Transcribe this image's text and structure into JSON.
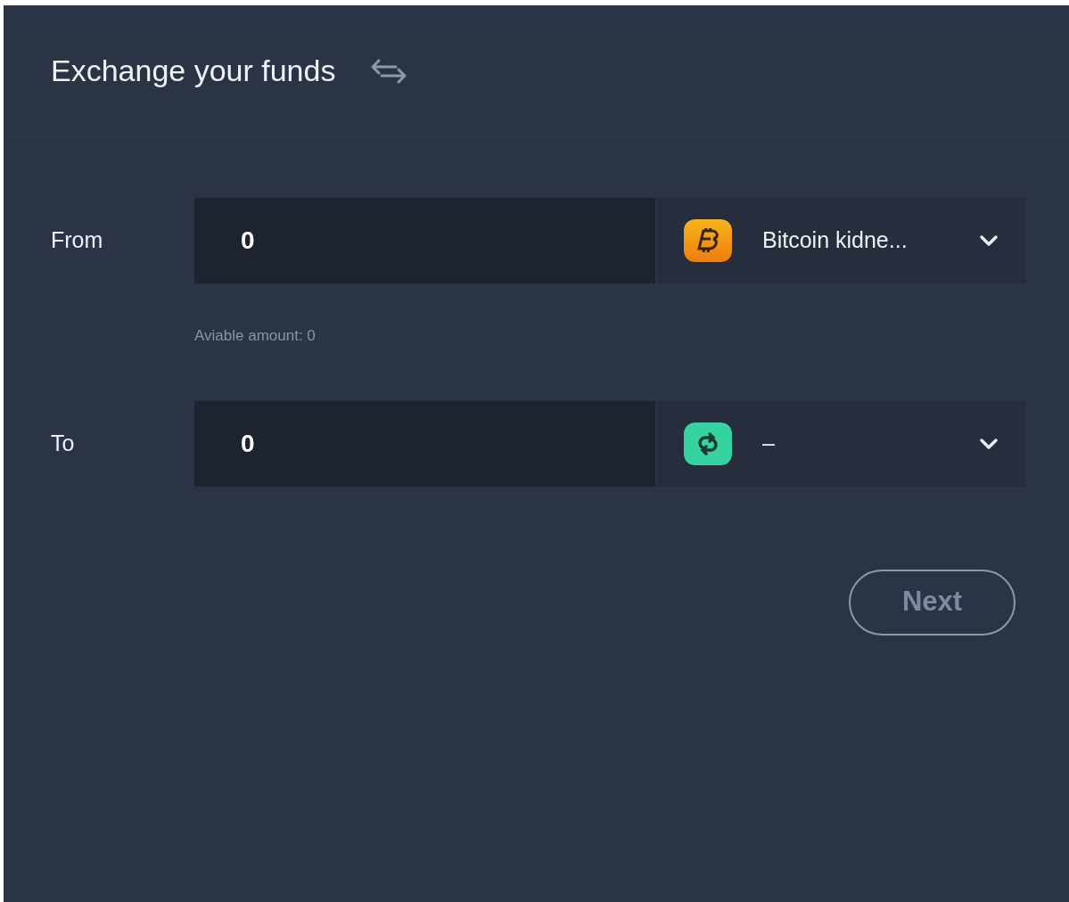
{
  "header": {
    "title": "Exchange your funds"
  },
  "rows": [
    {
      "label": "From",
      "amount": "0",
      "currency": {
        "kind": "bitcoin",
        "name": "Bitcoin kidne..."
      },
      "hint": "Aviable amount: 0"
    },
    {
      "label": "To",
      "amount": "0",
      "currency": {
        "kind": "exchange",
        "name": "–"
      }
    }
  ],
  "next_button": {
    "label": "Next",
    "disabled": true
  }
}
